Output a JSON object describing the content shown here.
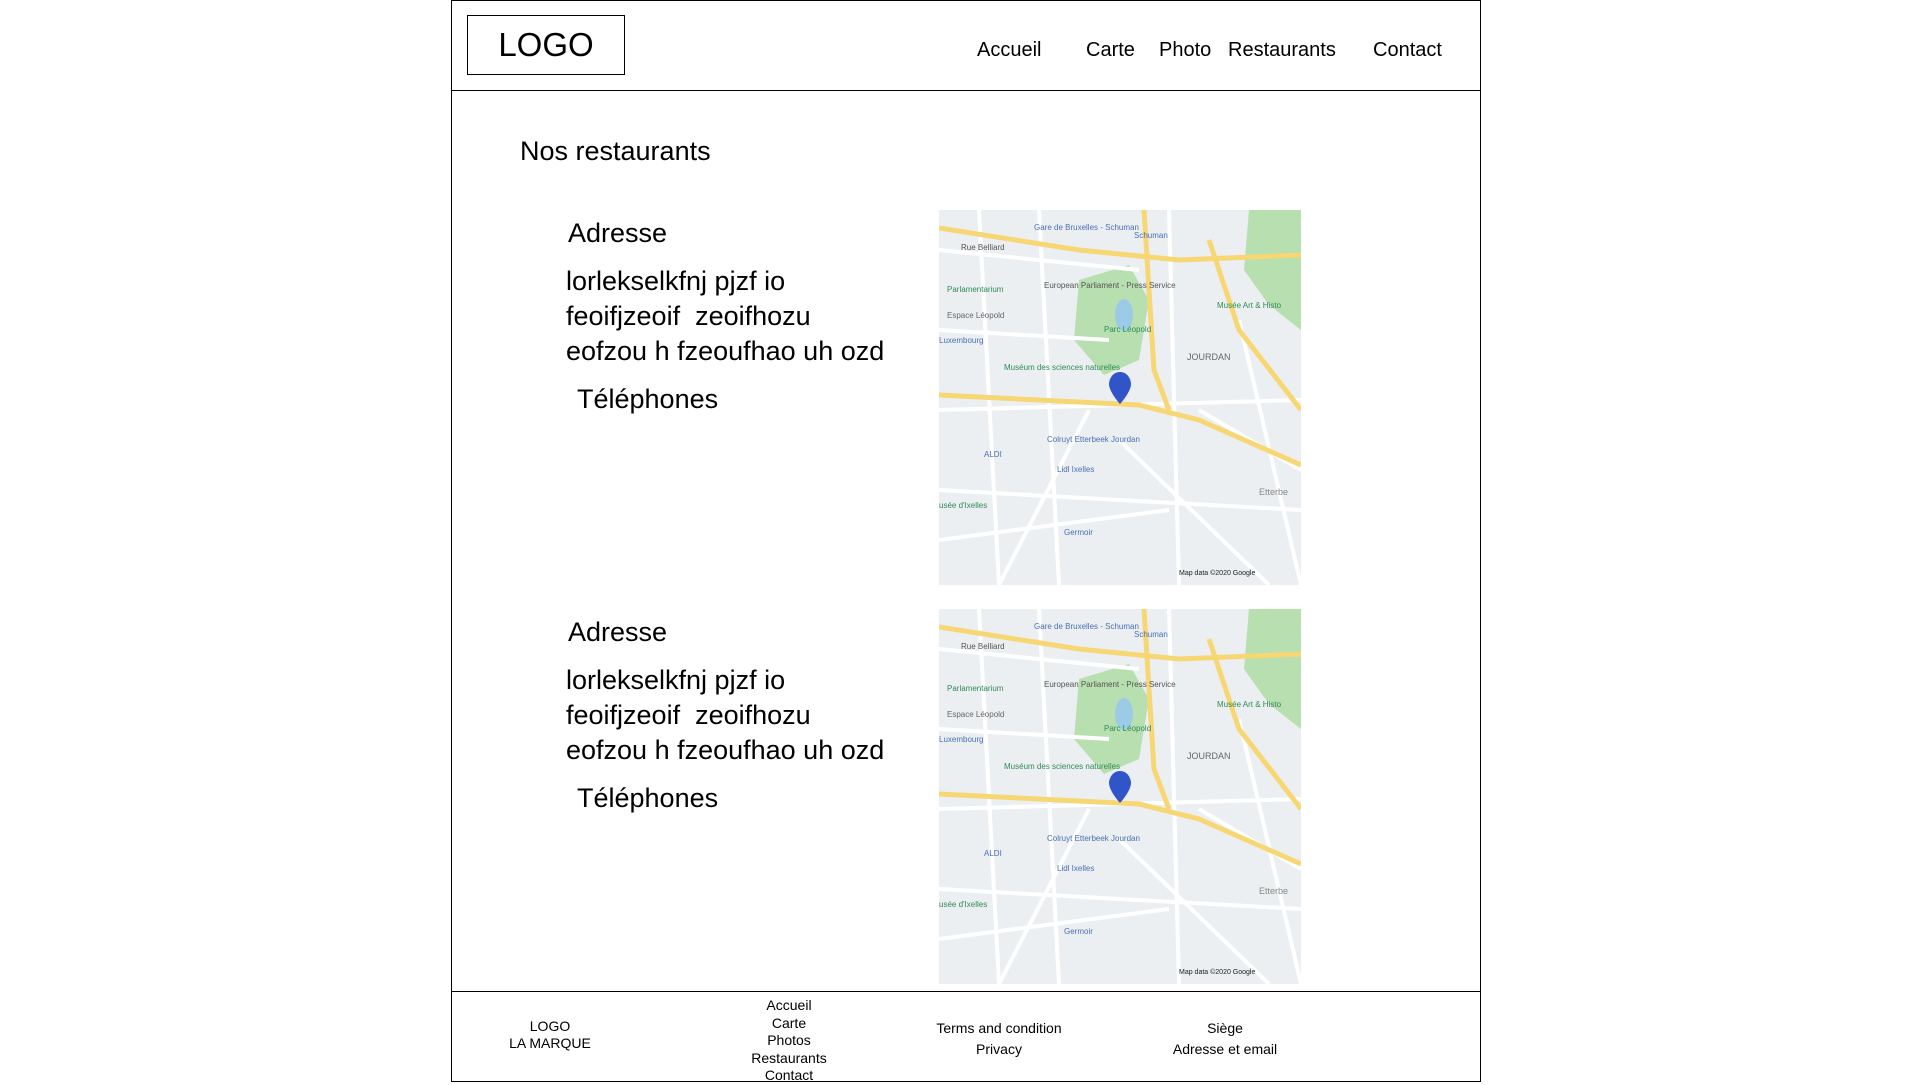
{
  "header": {
    "logo": "LOGO",
    "nav": [
      "Accueil",
      "Carte",
      "Photo",
      "Restaurants",
      "Contact"
    ]
  },
  "main": {
    "title": "Nos restaurants",
    "restaurants": [
      {
        "address_label": "Adresse",
        "address_lines": "lorlekselkfnj pjzf io\nfeoifjzeoif  zeoifhozu\neofzou h fzeoufhao uh ozd",
        "phone_label": "Téléphones"
      },
      {
        "address_label": "Adresse",
        "address_lines": "lorlekselkfnj pjzf io\nfeoifjzeoif  zeoifhozu\neofzou h fzeoufhao uh ozd",
        "phone_label": "Téléphones"
      }
    ],
    "map": {
      "labels": {
        "gare": "Gare de Bruxelles - Schuman",
        "schuman": "Schuman",
        "rue_belliard": "Rue Belliard",
        "parlamentarium": "Parlamentarium",
        "european_parliament": "European Parliament - Press Service",
        "espace_leopold": "Espace Léopold",
        "parc_leopold": "Parc Léopold",
        "luxembourg": "Luxembourg",
        "jourdan": "JOURDAN",
        "museum": "Muséum des sciences naturelles",
        "musee_art": "Musée Art & Histo",
        "colruyt": "Colruyt Etterbeek Jourdan",
        "aldi": "ALDI",
        "lidl": "Lidl Ixelles",
        "musee_ixelles": "usée d'Ixelles",
        "germoir": "Germoir",
        "etterbeek": "Etterbe",
        "credit": "Map data ©2020 Google"
      },
      "colors": {
        "background": "#eceff1",
        "road_major": "#f7d774",
        "road_minor": "#ffffff",
        "park": "#b7dfb0",
        "water": "#9ccbe8",
        "pin": "#2f55c8",
        "label_blue": "#4a6fb5",
        "label_green": "#2e8b57"
      }
    }
  },
  "footer": {
    "brand": [
      "LOGO",
      "LA MARQUE"
    ],
    "links": [
      "Accueil",
      "Carte",
      "Photos",
      "Restaurants",
      "Contact"
    ],
    "legal": [
      "Terms and condition",
      "Privacy"
    ],
    "contact": [
      "Siège",
      "Adresse et email"
    ]
  }
}
